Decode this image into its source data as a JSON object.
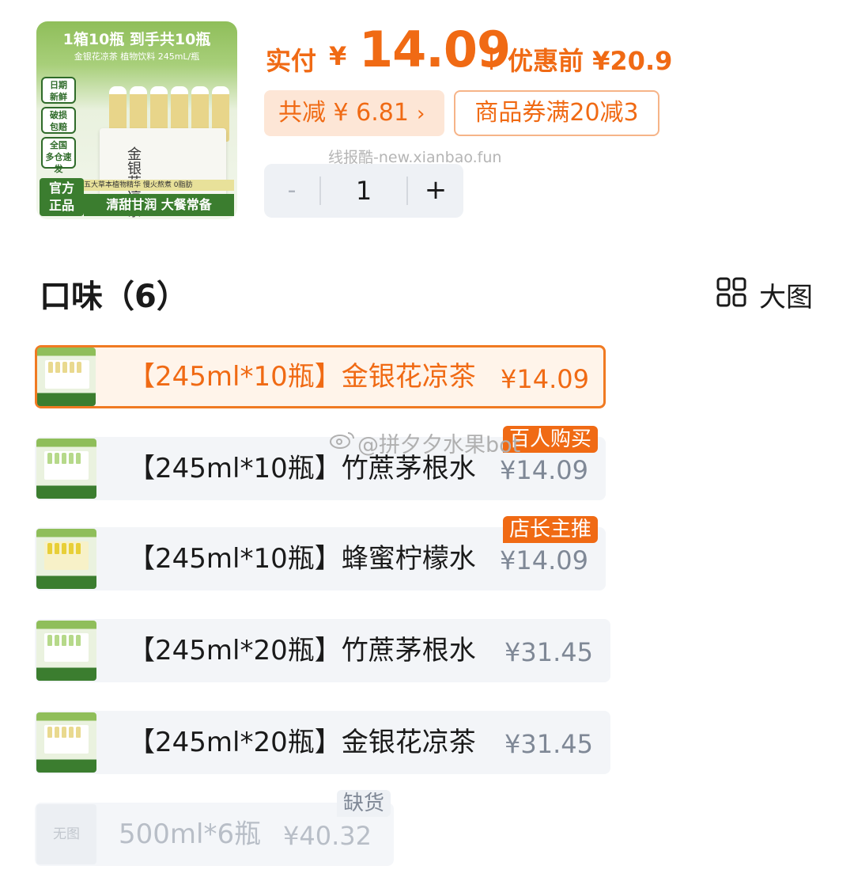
{
  "product_image": {
    "title": "1箱10瓶 到手共10瓶",
    "subtitle": "金银花凉茶 植物饮料 245mL/瓶",
    "side_tags": [
      "日期\n新鲜",
      "破损\n包赔",
      "全国\n多仓速发"
    ],
    "box_text": "金银花凉茶",
    "strip_text": "五大草本植物精华 慢火熬煮 0脂肪",
    "badge_left": "官方\n正品",
    "badge_right": "清甜甘润 大餐常备"
  },
  "price": {
    "paid_label": "实付",
    "paid_yen": "¥",
    "paid_amount": "14.09",
    "original_label": "优惠前 ¥20.9",
    "saving": "共减 ¥ 6.81",
    "saving_chevron": "›",
    "coupon": "商品券满20减3"
  },
  "watermark": "线报酷-new.xianbao.fun",
  "stepper": {
    "minus": "-",
    "quantity": "1",
    "plus": "+"
  },
  "flavor": {
    "title": "口味（6）",
    "view_label": "大图"
  },
  "options": [
    {
      "label": "【245ml*10瓶】金银花凉茶",
      "price": "¥14.09",
      "badge": "",
      "selected": true
    },
    {
      "label": "【245ml*10瓶】竹蔗茅根水",
      "price": "¥14.09",
      "badge": "百人购买"
    },
    {
      "label": "【245ml*10瓶】蜂蜜柠檬水",
      "price": "¥14.09",
      "badge": "店长主推"
    },
    {
      "label": "【245ml*20瓶】竹蔗茅根水",
      "price": "¥31.45",
      "badge": ""
    },
    {
      "label": "【245ml*20瓶】金银花凉茶",
      "price": "¥31.45",
      "badge": ""
    },
    {
      "label": "500ml*6瓶",
      "price": "¥40.32",
      "badge": "缺货",
      "noimg": "无图",
      "disabled": true
    }
  ],
  "weibo_watermark": "@拼夕夕水果bot",
  "colors": {
    "accent": "#f06a14",
    "brand_green": "#3b7d2f",
    "muted": "#7f8896"
  }
}
